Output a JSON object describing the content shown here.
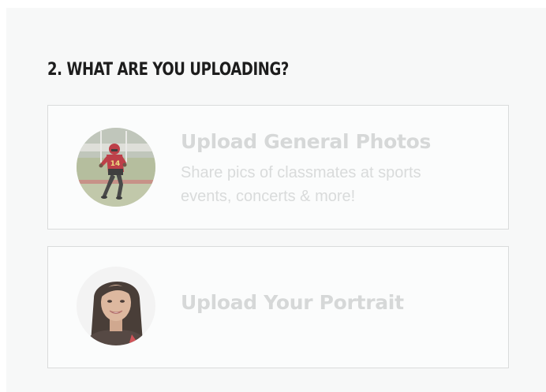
{
  "section": {
    "title": "2. WHAT ARE YOU UPLOADING?"
  },
  "options": [
    {
      "heading": "Upload General Photos",
      "description": "Share pics of classmates at sports events, concerts & more!",
      "thumbnail": "football-player-photo"
    },
    {
      "heading": "Upload Your Portrait",
      "thumbnail": "student-portrait-photo"
    }
  ],
  "colors": {
    "panel_bg": "#f7f8f8",
    "card_border": "#dadcdc",
    "title_text": "#1d1d1d",
    "muted_text": "#d6d8d8",
    "jersey_red": "#b3202a"
  }
}
